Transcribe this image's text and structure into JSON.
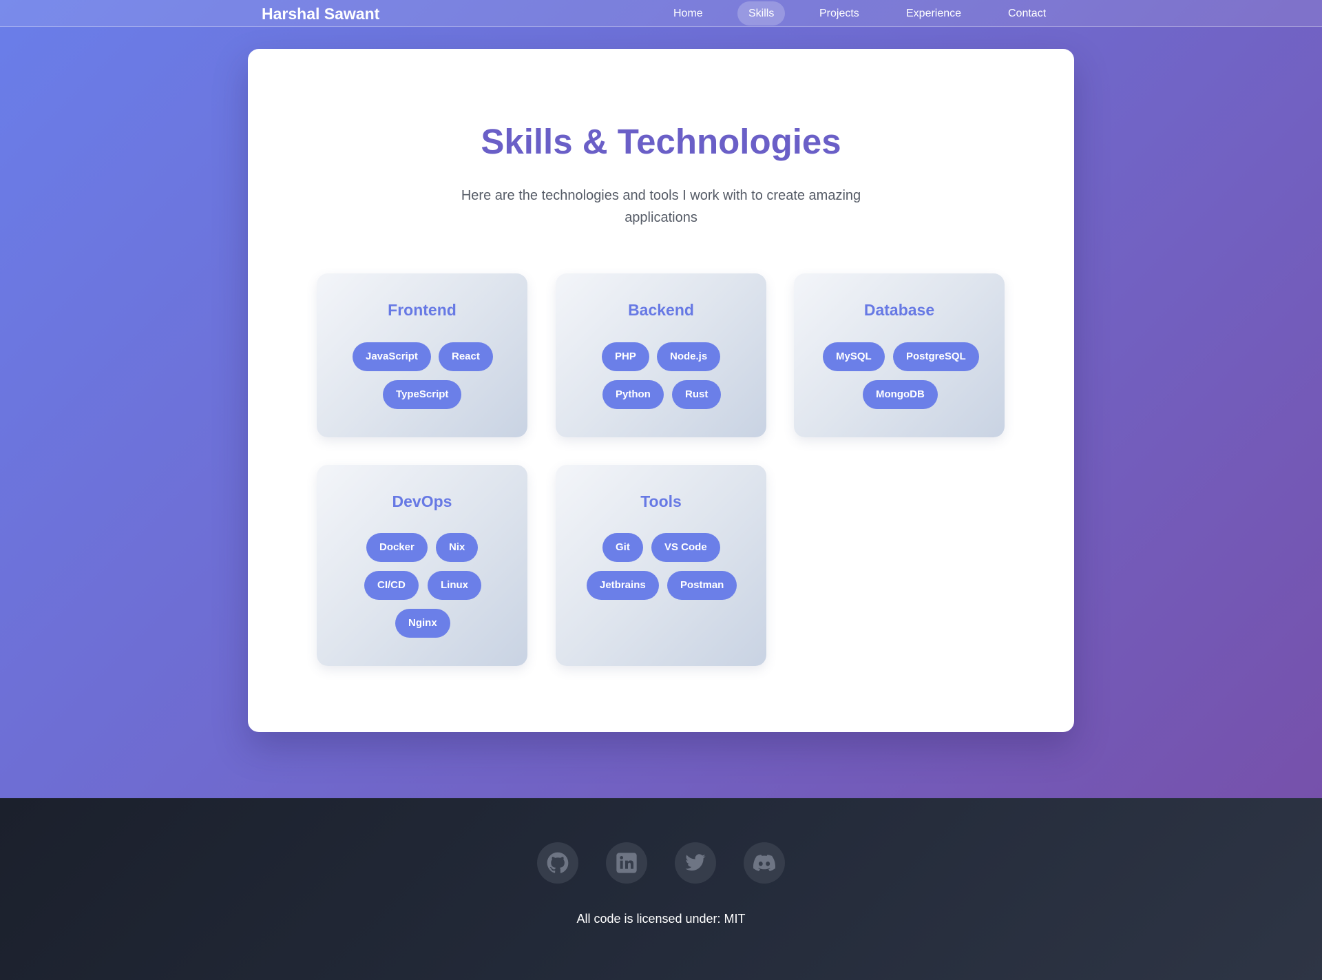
{
  "nav": {
    "brand": "Harshal Sawant",
    "links": [
      {
        "label": "Home",
        "active": false
      },
      {
        "label": "Skills",
        "active": true
      },
      {
        "label": "Projects",
        "active": false
      },
      {
        "label": "Experience",
        "active": false
      },
      {
        "label": "Contact",
        "active": false
      }
    ]
  },
  "skills": {
    "title": "Skills & Technologies",
    "subtitle": "Here are the technologies and tools I work with to create amazing applications",
    "categories": [
      {
        "name": "Frontend",
        "items": [
          "JavaScript",
          "React",
          "TypeScript"
        ]
      },
      {
        "name": "Backend",
        "items": [
          "PHP",
          "Node.js",
          "Python",
          "Rust"
        ]
      },
      {
        "name": "Database",
        "items": [
          "MySQL",
          "PostgreSQL",
          "MongoDB"
        ]
      },
      {
        "name": "DevOps",
        "items": [
          "Docker",
          "Nix",
          "CI/CD",
          "Linux",
          "Nginx"
        ]
      },
      {
        "name": "Tools",
        "items": [
          "Git",
          "VS Code",
          "Jetbrains",
          "Postman"
        ]
      }
    ]
  },
  "footer": {
    "social_icons": [
      "github-icon",
      "linkedin-icon",
      "twitter-icon",
      "discord-icon"
    ],
    "license": "All code is licensed under: MIT"
  },
  "colors": {
    "accent": "#6b7fe8",
    "title": "#6a5fc7",
    "gradient_start": "#6a7ee9",
    "gradient_end": "#7651ab",
    "footer_bg": "#1c2230"
  }
}
